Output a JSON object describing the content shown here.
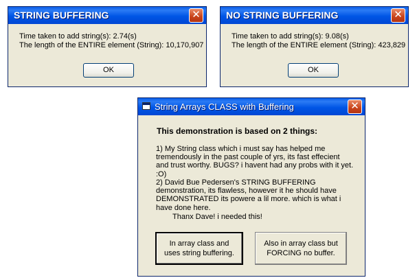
{
  "dialog1": {
    "title": "STRING BUFFERING",
    "line1": "Time taken to add string(s): 2.74(s)",
    "line2": "The length of the ENTIRE element (String): 10,170,907",
    "ok_label": "OK",
    "close_glyph": "✕"
  },
  "dialog2": {
    "title": "NO STRING BUFFERING",
    "line1": "Time taken to add string(s): 9.08(s)",
    "line2": "The length of the ENTIRE element (String): 423,829",
    "ok_label": "OK",
    "close_glyph": "✕"
  },
  "main": {
    "title": "String Arrays CLASS with Buffering",
    "close_glyph": "✕",
    "heading": "This demonstration is based on 2 things:",
    "para1": "1)  My String class which i must say has helped me tremendously in the past couple of yrs, its fast effecient and trust worthy. BUGS? i havent had any probs with it yet.  :O)",
    "para2": "2)  David Bue Pedersen's STRING BUFFERING demonstration, its flawless, however it he should have DEMONSTRATED its powere a lil more. which is what i have done here.",
    "thanks": "Thanx Dave! i needed this!",
    "button_buffer": "In array class and uses string buffering.",
    "button_nobuffer": "Also in array class but FORCING no buffer."
  },
  "icons": {
    "close": "close-icon",
    "app": "window-icon"
  },
  "colors": {
    "titlebar": "#0055e5",
    "dialog_bg": "#ece9d8",
    "close_button": "#c8431a"
  }
}
